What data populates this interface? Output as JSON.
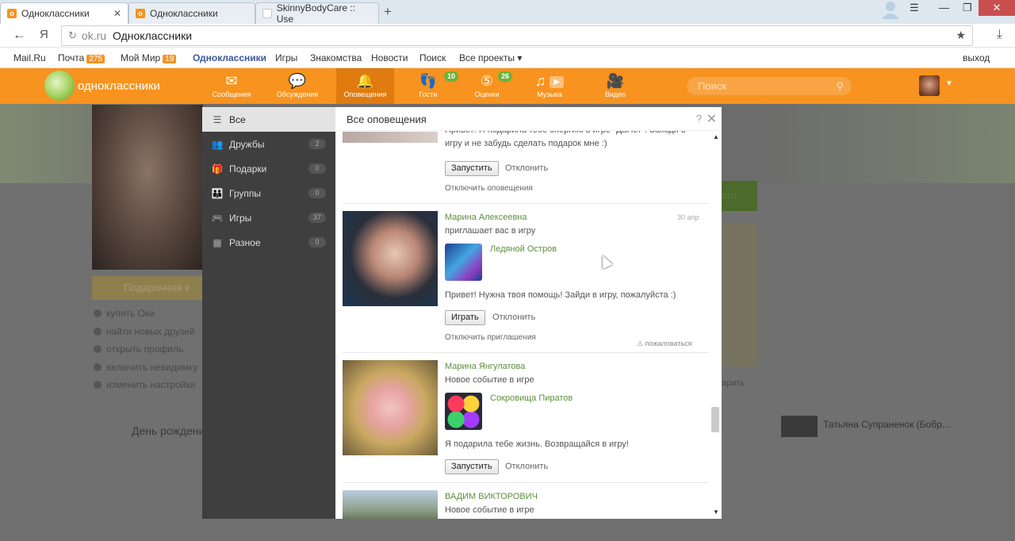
{
  "browser": {
    "tabs": [
      {
        "title": "Одноклассники",
        "favicon": "ok-icon"
      },
      {
        "title": "Одноклассники",
        "favicon": "ok-icon"
      },
      {
        "title": "SkinnyBodyCare :: Use",
        "favicon": "page-icon"
      }
    ],
    "address": {
      "domain": "ok.ru",
      "page_title": "Одноклассники"
    }
  },
  "mailru_bar": {
    "links": [
      {
        "label": "Mail.Ru"
      },
      {
        "label": "Почта",
        "badge": "275"
      },
      {
        "label": "Мой Мир",
        "badge": "19"
      },
      {
        "label": "Одноклассники"
      },
      {
        "label": "Игры"
      },
      {
        "label": "Знакомства"
      },
      {
        "label": "Новости"
      },
      {
        "label": "Поиск"
      },
      {
        "label": "Все проекты ▾"
      }
    ],
    "logout": "выход"
  },
  "ok_header": {
    "logo_text": "одноклассники",
    "nav": [
      {
        "label": "Сообщения",
        "icon": "envelope-icon"
      },
      {
        "label": "Обсуждения",
        "icon": "chat-icon"
      },
      {
        "label": "Оповещения",
        "icon": "bell-icon",
        "active": true
      },
      {
        "label": "Гости",
        "icon": "footprints-icon",
        "badge": "10"
      },
      {
        "label": "Оценки",
        "icon": "rating-icon",
        "badge": "26"
      },
      {
        "label": "Музыка",
        "icon": "music-icon"
      },
      {
        "label": "Видео",
        "icon": "video-icon"
      }
    ],
    "search_placeholder": "Поиск"
  },
  "background_page": {
    "gift_label": "Подарочная к",
    "links": [
      "купить Оки",
      "найти новых друзей",
      "открыть профиль",
      "включить невидимку",
      "изменить настройки"
    ],
    "birthday_heading": "День рождения",
    "green_button_fragment": "ото",
    "right_friend": "Татьяна Супраненок (Бобр...",
    "gift_fragment": "арить"
  },
  "categories": [
    {
      "label": "Все",
      "icon": "list-icon",
      "active": true
    },
    {
      "label": "Дружбы",
      "icon": "friends-icon",
      "count": "2"
    },
    {
      "label": "Подарки",
      "icon": "gift-icon",
      "count": "0"
    },
    {
      "label": "Группы",
      "icon": "groups-icon",
      "count": "0"
    },
    {
      "label": "Игры",
      "icon": "gamepad-icon",
      "count": "37"
    },
    {
      "label": "Разное",
      "icon": "grid-icon",
      "count": "0"
    }
  ],
  "popup": {
    "title": "Все оповещения",
    "help": "?",
    "notifications": [
      {
        "message": "Привет! Я подарила тебе энергию в игре \"ДаНет\". Заходи в игру и не забудь сделать подарок мне :)",
        "primary_button": "Запустить",
        "decline": "Отклонить",
        "footer_link": "Отключить оповещения"
      },
      {
        "name": "Марина Алексеевна",
        "subtitle": "приглашает вас в игру",
        "date": "30 апр",
        "game": "Ледяной Остров",
        "message": "Привет! Нужна твоя помощь! Зайди в игру, пожалуйста :)",
        "primary_button": "Играть",
        "decline": "Отклонить",
        "footer_link": "Отключить приглашения",
        "complain": "пожаловаться"
      },
      {
        "name": "Марина Янгулатова",
        "subtitle": "Новое событие в игре",
        "game": "Сокровища Пиратов",
        "message": "Я подарила тебе жизнь. Возвращайся в игру!",
        "primary_button": "Запустить",
        "decline": "Отклонить"
      },
      {
        "name": "ВАДИМ ВИКТОРОВИЧ",
        "subtitle": "Новое событие в игре"
      }
    ]
  },
  "colors": {
    "ok_orange": "#f7931e",
    "name_green": "#5d8f3e"
  }
}
